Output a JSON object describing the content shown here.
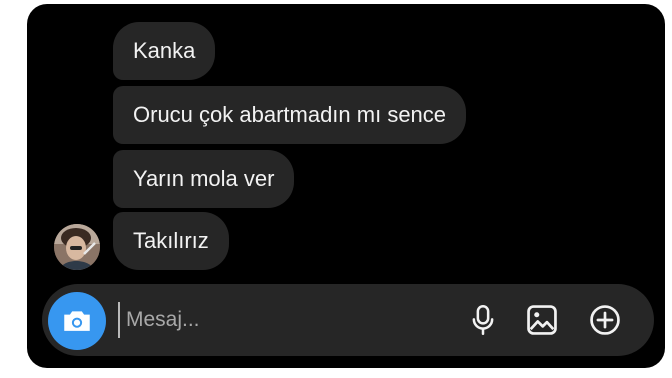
{
  "messages": [
    {
      "text": "Kanka"
    },
    {
      "text": "Orucu çok abartmadın mı sence"
    },
    {
      "text": "Yarın mola ver"
    },
    {
      "text": "Takılırız"
    }
  ],
  "composer": {
    "placeholder": "Mesaj...",
    "camera_icon": "camera-icon",
    "mic_icon": "microphone-icon",
    "gallery_icon": "image-icon",
    "plus_icon": "plus-circle-icon"
  },
  "colors": {
    "background": "#000000",
    "bubble": "#262626",
    "text": "#f2f2f2",
    "accent": "#3797f0"
  }
}
